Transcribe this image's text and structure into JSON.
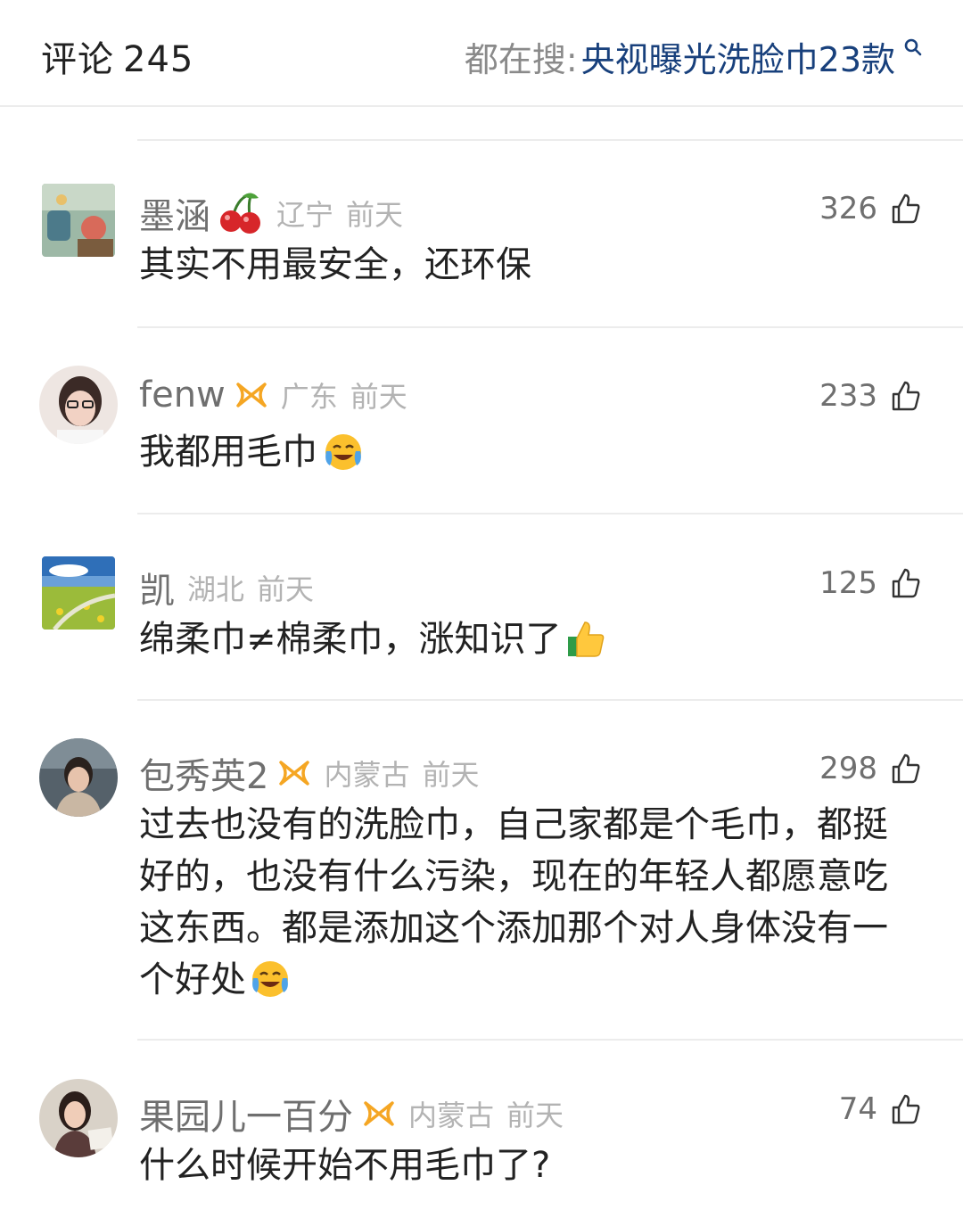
{
  "header": {
    "title": "评论",
    "count": "245",
    "trend_label": "都在搜:",
    "trend_topic": "央视曝光洗脸巾23款"
  },
  "icons": {
    "search": "search-icon",
    "like": "thumb-up-icon",
    "badge": "vip-ribbon-icon"
  },
  "colors": {
    "topic": "#18407c",
    "badge": "#f5a623",
    "meta": "#b3b3b3"
  },
  "comments": [
    {
      "user": "墨涵",
      "region": "辽宁",
      "time": "前天",
      "likes": "326",
      "text": "其实不用最安全，还环保"
    },
    {
      "user": "fenw",
      "region": "广东",
      "time": "前天",
      "likes": "233",
      "text": "我都用毛巾"
    },
    {
      "user": "凯",
      "region": "湖北",
      "time": "前天",
      "likes": "125",
      "text": "绵柔巾≠棉柔巾，涨知识了"
    },
    {
      "user": "包秀英2",
      "region": "内蒙古",
      "time": "前天",
      "likes": "298",
      "text": "过去也没有的洗脸巾，自己家都是个毛巾，都挺好的，也没有什么污染，现在的年轻人都愿意吃这东西。都是添加这个添加那个对人身体没有一个好处"
    },
    {
      "user": "果园儿一百分",
      "region": "内蒙古",
      "time": "前天",
      "likes": "74",
      "text": "什么时候开始不用毛巾了?"
    }
  ]
}
